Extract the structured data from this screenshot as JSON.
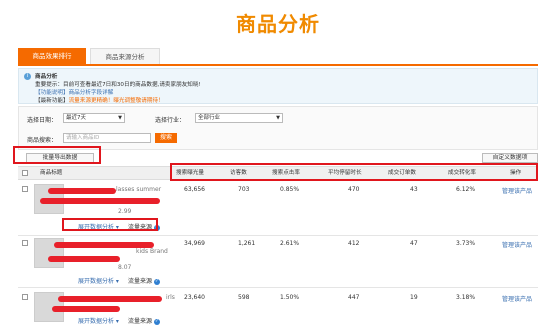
{
  "banner": {
    "title": "商品分析"
  },
  "tabs": [
    {
      "label": "商品效果排行"
    },
    {
      "label": "商品来源分析"
    }
  ],
  "notice": {
    "title": "商品分析",
    "line1": "重要提示：目前可查看最近7日和30日的商品数据,请卖家朋友知晓!",
    "line2": "【功能说明】商品分析字段详解",
    "line3_prefix": "【最新功能】",
    "line3_link": "流量来源更精确！曝光调整敬请期待！"
  },
  "filters": {
    "date_label": "选择日期：",
    "date_value": "最近7天",
    "industry_label": "选择行业：",
    "industry_value": "全部行业",
    "search_label": "商品搜索：",
    "search_placeholder": "请输入商品ID",
    "search_button": "搜索"
  },
  "toolbar": {
    "export_button": "批量导出数据",
    "custom_button": "自定义数据项"
  },
  "table": {
    "headers": [
      "商品标题",
      "搜索曝光量",
      "访客数",
      "搜索点击率",
      "平均停留时长",
      "成交订单数",
      "成交转化率",
      "操作"
    ],
    "rows": [
      {
        "title_fragment": "lasses summer",
        "price": "2.99",
        "exposure": "63,656",
        "visitors": "703",
        "ctr": "0.85%",
        "stay": "470",
        "orders": "43",
        "cvr": "6.12%",
        "action": "管理该产品",
        "expand": "展开数据分析",
        "source": "流量来源"
      },
      {
        "title_fragment": "kids Brand",
        "price": "8.07",
        "exposure": "34,969",
        "visitors": "1,261",
        "ctr": "2.61%",
        "stay": "412",
        "orders": "47",
        "cvr": "3.73%",
        "action": "管理该产品",
        "expand": "展开数据分析",
        "source": "流量来源"
      },
      {
        "title_fragment": "irls",
        "price": "",
        "exposure": "23,640",
        "visitors": "598",
        "ctr": "1.50%",
        "stay": "447",
        "orders": "19",
        "cvr": "3.18%",
        "action": "管理该产品",
        "expand": "展开数据分析",
        "source": "流量来源"
      }
    ]
  },
  "colors": {
    "accent": "#f56a00",
    "highlight": "#e0161d",
    "link": "#3a6fb0",
    "notice_bg": "#eef6fb"
  }
}
